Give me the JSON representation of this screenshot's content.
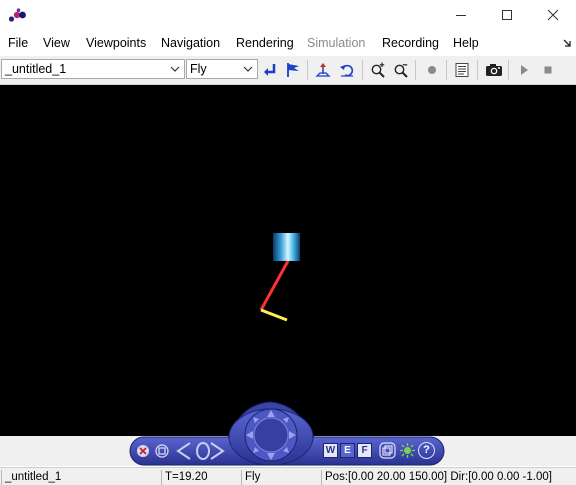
{
  "window": {
    "app_icon": "purple-balls-logo-icon",
    "controls": [
      "minimize-icon",
      "maximize-icon",
      "close-icon"
    ]
  },
  "menu": {
    "items": [
      {
        "label": "File",
        "enabled": true
      },
      {
        "label": "View",
        "enabled": true
      },
      {
        "label": "Viewpoints",
        "enabled": true
      },
      {
        "label": "Navigation",
        "enabled": true
      },
      {
        "label": "Rendering",
        "enabled": true
      },
      {
        "label": "Simulation",
        "enabled": false
      },
      {
        "label": "Recording",
        "enabled": true
      },
      {
        "label": "Help",
        "enabled": true
      }
    ],
    "overflow_icon": "menu-overflow-arrow-icon"
  },
  "toolbar": {
    "viewpoint_combo": "_untitled_1",
    "navigation_combo": "Fly",
    "buttons": [
      "return-arrow-icon",
      "flag-icon",
      "straighten-up-icon",
      "undo-move-icon",
      "zoom-in-icon",
      "zoom-out-icon",
      "record-icon",
      "console-icon",
      "snapshot-camera-icon",
      "play-icon",
      "stop-icon"
    ]
  },
  "viewport": {
    "background": "#000000",
    "scene_colors": {
      "cylinder": "#5ec8ec",
      "red_segment": "#ff3030",
      "yellow_segment": "#ffee55"
    }
  },
  "navigation_panel": {
    "accent": "#3a43a8",
    "buttons": [
      "close-x-icon",
      "restore-icon",
      "left-arrow-icon",
      "right-arrow-icon",
      "joystick-icon",
      "w-icon",
      "e-icon",
      "f-icon",
      "layers-icon",
      "light-icon",
      "help-icon"
    ],
    "letters": {
      "w": "W",
      "e": "E",
      "f": "F",
      "help": "?"
    }
  },
  "status": {
    "viewpoint": "_untitled_1",
    "time": "T=19.20",
    "mode": "Fly",
    "position": "Pos:[0.00 20.00 150.00] Dir:[0.00 0.00 -1.00]"
  }
}
